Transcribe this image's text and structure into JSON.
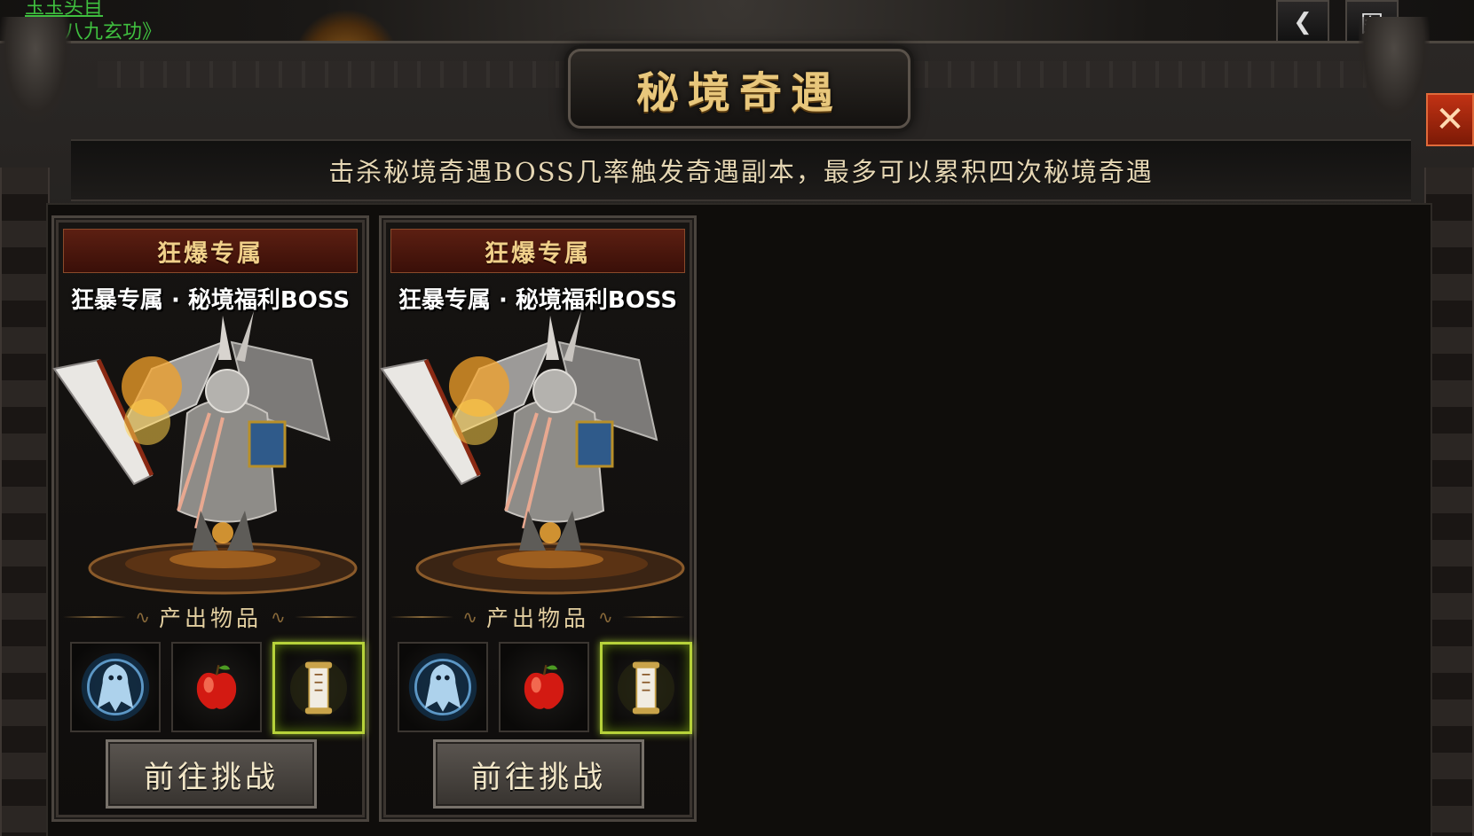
{
  "background": {
    "chat_line_1": "玉玉头目",
    "chat_line_2": "陈《八九玄功》",
    "back_icon_glyph": "❮",
    "map_button_label": "图"
  },
  "window": {
    "title": "秘境奇遇",
    "close_glyph": "✕",
    "notice": "击杀秘境奇遇BOSS几率触发奇遇副本，最多可以累积四次秘境奇遇"
  },
  "cards": [
    {
      "header": "狂爆专属",
      "subtitle": "狂暴专属 · 秘境福利BOSS",
      "boss_icon": "armored-beast-boss",
      "output_label": "产出物品",
      "items": [
        {
          "icon": "ghost-spirit-icon",
          "rare": false
        },
        {
          "icon": "red-apple-icon",
          "rare": false
        },
        {
          "icon": "scroll-icon",
          "rare": true
        }
      ],
      "button_label": "前往挑战"
    },
    {
      "header": "狂爆专属",
      "subtitle": "狂暴专属 · 秘境福利BOSS",
      "boss_icon": "armored-beast-boss",
      "output_label": "产出物品",
      "items": [
        {
          "icon": "ghost-spirit-icon",
          "rare": false
        },
        {
          "icon": "red-apple-icon",
          "rare": false
        },
        {
          "icon": "scroll-icon",
          "rare": true
        }
      ],
      "button_label": "前往挑战"
    }
  ],
  "colors": {
    "title_gold": "#e8c77c",
    "header_red": "#5c1f12",
    "rare_border": "#b7d23a",
    "close_red": "#c13214"
  }
}
